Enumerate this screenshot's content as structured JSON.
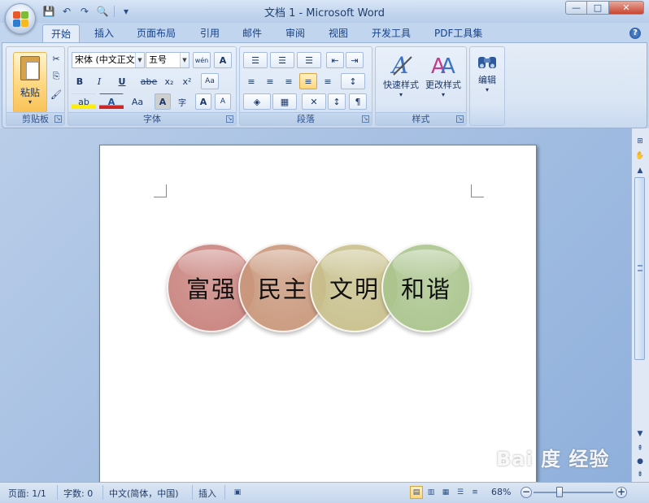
{
  "window": {
    "title": "文档 1 - Microsoft Word",
    "controls": {
      "minimize": "—",
      "maximize": "□",
      "close": "✕"
    }
  },
  "qat": {
    "save": "💾",
    "undo": "↶",
    "redo": "↷",
    "preview": "🔍",
    "customize": "▾"
  },
  "tabs": [
    "开始",
    "插入",
    "页面布局",
    "引用",
    "邮件",
    "审阅",
    "视图",
    "开发工具",
    "PDF工具集"
  ],
  "active_tab": "开始",
  "help": "?",
  "ribbon": {
    "clipboard": {
      "label": "剪贴板",
      "paste": "粘贴",
      "paste_dd": "▾",
      "cut": "✂",
      "copy": "⎘",
      "format_painter": "🖌"
    },
    "font": {
      "label": "字体",
      "font_name": "宋体 (中文正文)",
      "font_size": "五号",
      "grow": "A",
      "shrink": "A",
      "phonetic": "wén",
      "border": "A",
      "bold": "B",
      "italic": "I",
      "underline": "U",
      "strike": "abe",
      "subscript": "x₂",
      "superscript": "x²",
      "clear": "Aa",
      "highlight": "ab",
      "font_color": "A",
      "case": "Aa",
      "char_shade": "A",
      "enclose": "字",
      "grow_font": "A",
      "shrink_font": "A"
    },
    "paragraph": {
      "label": "段落",
      "bullets": "☰",
      "numbering": "☰",
      "multilevel": "☰",
      "decrease_indent": "⇤",
      "increase_indent": "⇥",
      "align_left": "≡",
      "center": "≡",
      "align_right": "≡",
      "justify": "≡",
      "distributed": "≡",
      "line_spacing": "↕",
      "shading": "◈",
      "borders": "▦",
      "asian_layout": "✕",
      "sort": "↕",
      "show_marks": "¶"
    },
    "styles": {
      "label": "样式",
      "quick_styles": "快速样式",
      "change_styles": "更改样式"
    },
    "editing": {
      "label": "编辑",
      "button": "编辑"
    }
  },
  "document": {
    "circles": [
      {
        "text": "富强",
        "color": "#c9837e"
      },
      {
        "text": "民主",
        "color": "#c9987c"
      },
      {
        "text": "文明",
        "color": "#c8c08c"
      },
      {
        "text": "和谐",
        "color": "#aac48d"
      }
    ]
  },
  "watermark": "Bai 度 经验",
  "statusbar": {
    "page": "页面: 1/1",
    "words": "字数: 0",
    "language": "中文(简体，中国)",
    "mode": "插入",
    "zoom": "68%",
    "zoom_minus": "−",
    "zoom_plus": "+"
  },
  "colors": {
    "ribbon": "#dbe6f5",
    "doc_bg": "#a8c1e3",
    "accent": "#15428b"
  }
}
